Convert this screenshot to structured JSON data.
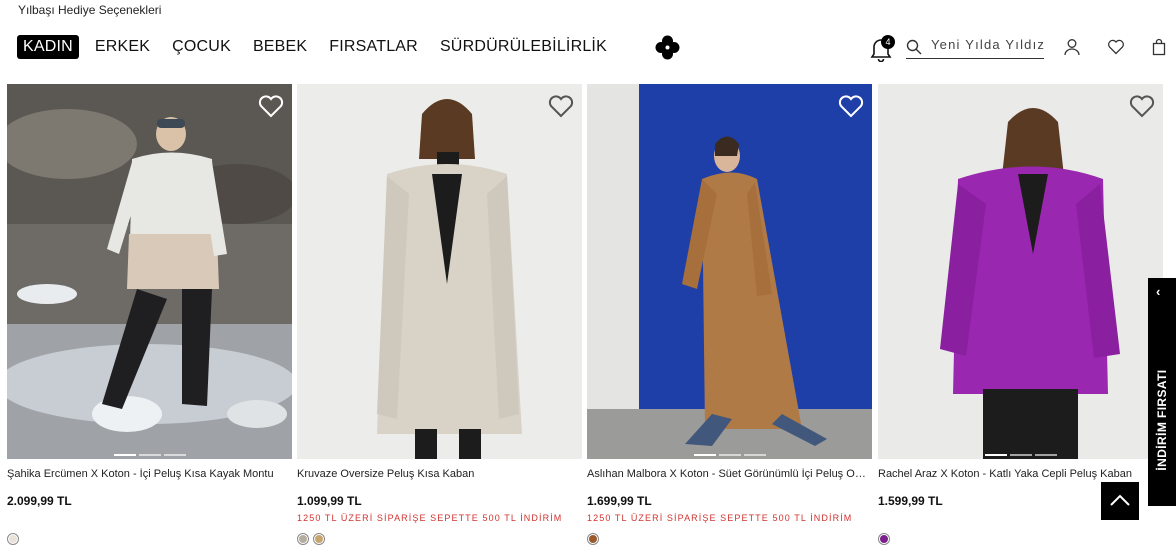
{
  "promo_link": "Yılbaşı Hediye Seçenekleri",
  "nav": [
    {
      "label": "KADIN",
      "active": true
    },
    {
      "label": "ERKEK",
      "active": false
    },
    {
      "label": "ÇOCUK",
      "active": false
    },
    {
      "label": "BEBEK",
      "active": false
    },
    {
      "label": "FIRSATLAR",
      "active": false
    },
    {
      "label": "SÜRDÜRÜLEBİLİRLİK",
      "active": false
    }
  ],
  "header": {
    "notification_count": "4",
    "search_placeholder": "Yeni Yılda Yıldız",
    "icons": [
      "bell-icon",
      "search-icon",
      "user-icon",
      "heart-icon",
      "bag-icon"
    ]
  },
  "products": [
    {
      "name": "Şahika Ercümen X Koton - İçi Peluş Kısa Kayak Montu",
      "price": "2.099,99 TL",
      "promo": "",
      "swatches": [
        "#e8e2d8"
      ]
    },
    {
      "name": "Kruvaze Oversize Peluş Kısa Kaban",
      "price": "1.099,99 TL",
      "promo": "1250 TL ÜZERİ SİPARİŞE SEPETTE 500 TL İNDİRİM",
      "swatches": [
        "#b5ad9f",
        "#c9a56e"
      ]
    },
    {
      "name": "Aslıhan Malbora X Koton - Süet Görünümlü İçi Peluş Oversize Kaban",
      "price": "1.699,99 TL",
      "promo": "1250 TL ÜZERİ SİPARİŞE SEPETTE 500 TL İNDİRİM",
      "swatches": [
        "#9a5a2c"
      ]
    },
    {
      "name": "Rachel Araz X Koton - Katlı Yaka Cepli Peluş Kaban",
      "price": "1.599,99 TL",
      "promo": "",
      "swatches": [
        "#7a1f8c"
      ]
    }
  ],
  "side_tab": {
    "label": "İNDİRİM FIRSATI",
    "arrow": "‹"
  },
  "colors": {
    "accent": "#000000",
    "promo_red": "#d0332f"
  }
}
